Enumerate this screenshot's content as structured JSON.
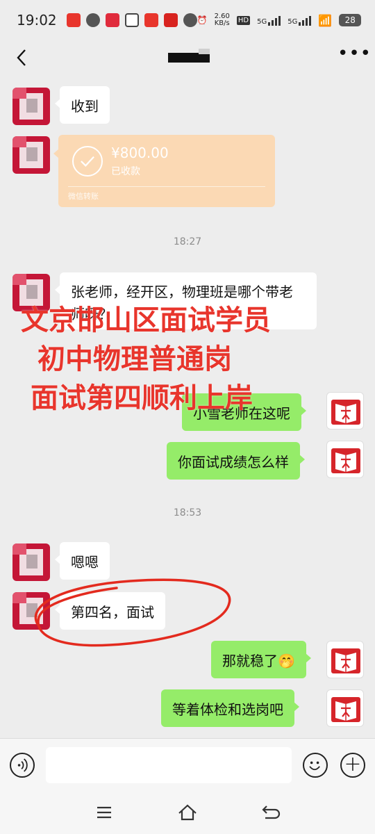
{
  "status_bar": {
    "time": "19:02",
    "net_speed_value": "2.60",
    "net_speed_unit": "KB/s",
    "hd_label": "HD",
    "sig1_label": "5G",
    "sig2_label": "5G",
    "battery": "28"
  },
  "messages": {
    "m1": "收到",
    "transfer_amount": "¥800.00",
    "transfer_status": "已收款",
    "transfer_footer": "微信转账",
    "time1": "18:27",
    "m2": "张老师，经开区，物理班是哪个带老师呀？",
    "m3": "小雪老师在这呢",
    "m4": "你面试成绩怎么样",
    "time2": "18:53",
    "m5": "嗯嗯",
    "m6": "第四名，面试",
    "m7": "那就稳了🤭",
    "m8": "等着体检和选岗吧"
  },
  "overlay": {
    "line1": "文京邯山区面试学员",
    "line2": "初中物理普通岗",
    "line3": "面试第四顺利上岸"
  },
  "colors": {
    "accent_red": "#e8352c",
    "bubble_green": "#95ec69",
    "transfer_orange": "#fbd9b4"
  }
}
